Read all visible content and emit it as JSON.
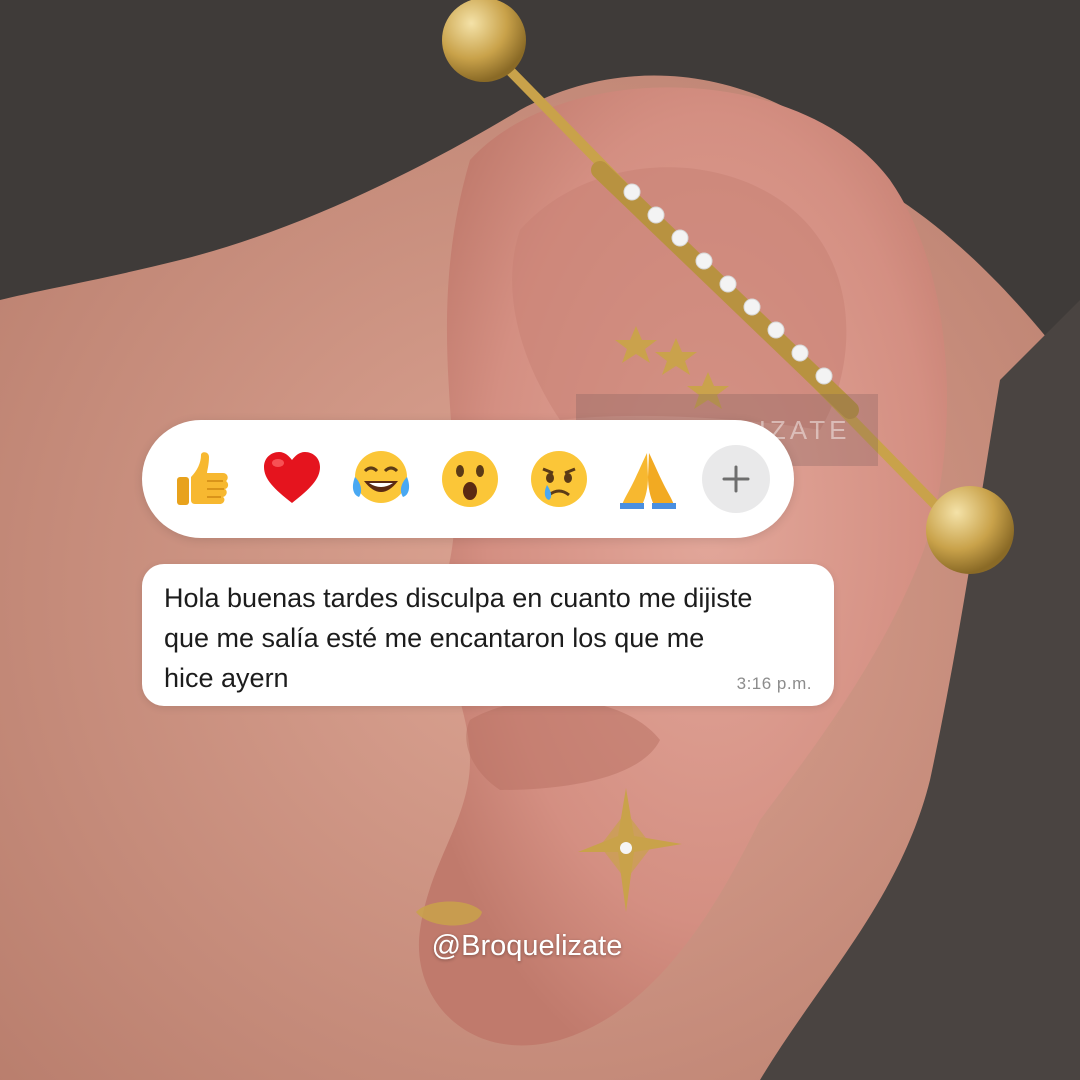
{
  "reactions": {
    "items": [
      {
        "name": "thumbs-up"
      },
      {
        "name": "red-heart"
      },
      {
        "name": "tears-of-joy"
      },
      {
        "name": "open-mouth"
      },
      {
        "name": "crying-face"
      },
      {
        "name": "folded-hands"
      }
    ],
    "add_button_icon": "plus-icon"
  },
  "message": {
    "text": "Hola buenas tardes disculpa en cuanto me dijiste que me salía esté me encantaron los que me hice ayern",
    "time": "3:16 p.m."
  },
  "watermark": {
    "text": "BROQUELIZATE"
  },
  "brand": {
    "handle": "@Broquelizate"
  },
  "colors": {
    "bubble": "#ffffff",
    "add_button": "#e9e9ea",
    "timestamp": "#8c8c8c",
    "skin": "#d49a88",
    "hair": "#3e3a38",
    "gold": "#c9a24a"
  }
}
